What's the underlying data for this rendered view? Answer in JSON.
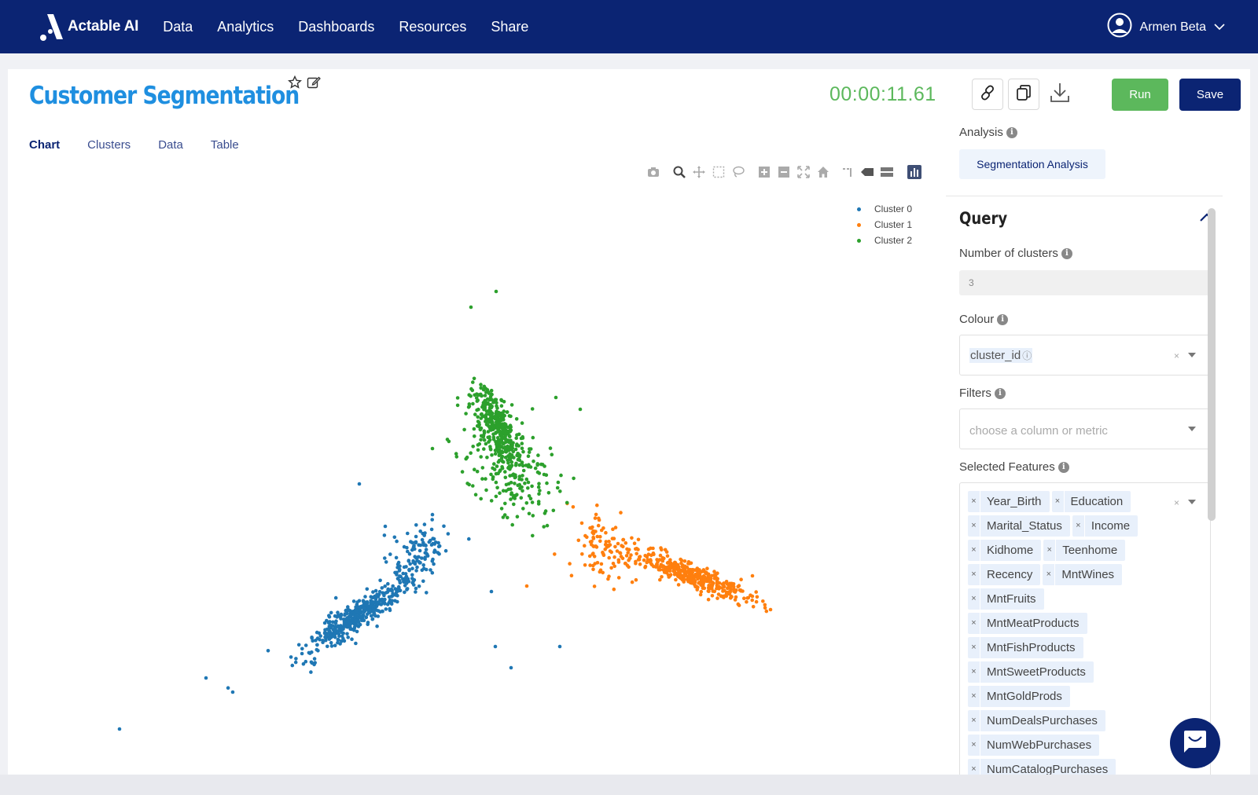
{
  "brand": {
    "name": "Actable AI"
  },
  "nav": {
    "items": [
      "Data",
      "Analytics",
      "Dashboards",
      "Resources",
      "Share"
    ]
  },
  "user": {
    "name": "Armen Beta"
  },
  "page": {
    "title": "Customer Segmentation",
    "timer": "00:00:11.61"
  },
  "actions": {
    "run": "Run",
    "save": "Save"
  },
  "tabs": [
    "Chart",
    "Clusters",
    "Data",
    "Table"
  ],
  "panel": {
    "analysis_label": "Analysis",
    "analysis_value": "Segmentation Analysis",
    "query_title": "Query",
    "num_clusters_label": "Number of clusters",
    "num_clusters_value": "3",
    "colour_label": "Colour",
    "colour_value": "cluster_id",
    "filters_label": "Filters",
    "filters_placeholder": "choose a column or metric",
    "features_label": "Selected Features",
    "features": [
      "Year_Birth",
      "Education",
      "Marital_Status",
      "Income",
      "Kidhome",
      "Teenhome",
      "Recency",
      "MntWines",
      "MntFruits",
      "MntMeatProducts",
      "MntFishProducts",
      "MntSweetProducts",
      "MntGoldProds",
      "NumDealsPurchases",
      "NumWebPurchases",
      "NumCatalogPurchases"
    ]
  },
  "colors": {
    "nav": "#0b2473",
    "cluster0": "#1f77b4",
    "cluster1": "#ff7f0e",
    "cluster2": "#2ca02c",
    "run": "#5cb85c"
  },
  "chart_data": {
    "type": "scatter",
    "series": [
      {
        "name": "Cluster 0",
        "color": "#1f77b4"
      },
      {
        "name": "Cluster 1",
        "color": "#ff7f0e"
      },
      {
        "name": "Cluster 2",
        "color": "#2ca02c"
      }
    ],
    "legend_position": "top-right",
    "grid": false
  }
}
